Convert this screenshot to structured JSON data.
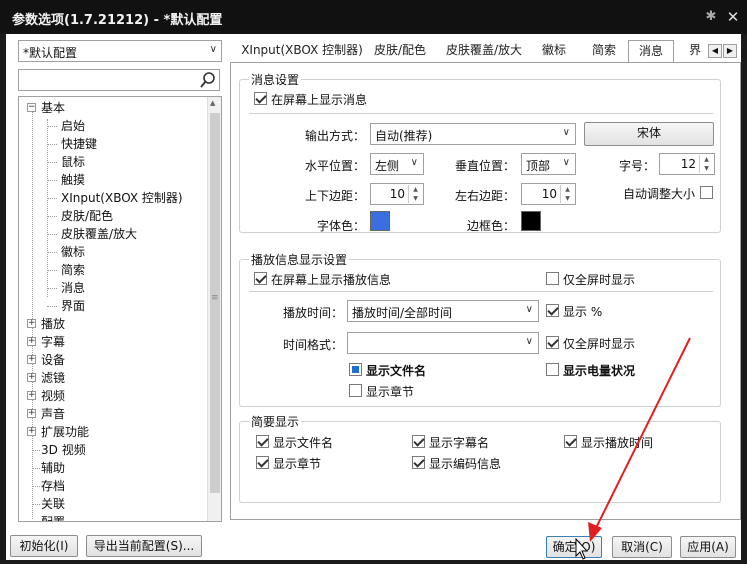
{
  "window": {
    "title": "参数选项(1.7.21212) - *默认配置",
    "pin_icon": "pin-icon",
    "close_icon": "close-icon"
  },
  "profile": {
    "selected": "*默认配置"
  },
  "search": {
    "value": "",
    "icon": "search-icon"
  },
  "tree": {
    "basic": "基本",
    "children": [
      "启始",
      "快捷键",
      "鼠标",
      "触摸",
      "XInput(XBOX 控制器)",
      "皮肤/配色",
      "皮肤覆盖/放大",
      "徽标",
      "简索",
      "消息",
      "界面"
    ],
    "others": [
      "播放",
      "字幕",
      "设备",
      "滤镜",
      "视频",
      "声音",
      "扩展功能",
      "3D 视频",
      "辅助",
      "存档",
      "关联",
      "配置"
    ]
  },
  "tabs": [
    "XInput(XBOX 控制器)",
    "皮肤/配色",
    "皮肤覆盖/放大",
    "徽标",
    "简索",
    "消息",
    "界"
  ],
  "active_tab": "消息",
  "msg": {
    "group_title": "消息设置",
    "show_on_screen": "在屏幕上显示消息",
    "output_label": "输出方式：",
    "output_value": "自动(推荐)",
    "font_button": "宋体",
    "hpos_label": "水平位置：",
    "hpos_value": "左侧",
    "vpos_label": "垂直位置：",
    "vpos_value": "顶部",
    "size_label": "字号：",
    "size_value": "12",
    "tb_margin_label": "上下边距：",
    "tb_margin_value": "10",
    "lr_margin_label": "左右边距：",
    "lr_margin_value": "10",
    "autosize_label": "自动调整大小",
    "font_color_label": "字体色：",
    "font_color": "#3b6fe0",
    "border_color_label": "边框色：",
    "border_color": "#000000"
  },
  "play": {
    "group_title": "播放信息显示设置",
    "show_play_info": "在屏幕上显示播放信息",
    "fullscreen_only": "仅全屏时显示",
    "time_label": "播放时间：",
    "time_value": "播放时间/全部时间",
    "show_percent": "显示 %",
    "format_label": "时间格式：",
    "format_value": "",
    "fullscreen_only2": "仅全屏时显示",
    "show_filename": "显示文件名",
    "show_battery": "显示电量状况",
    "show_chapter": "显示章节"
  },
  "brief": {
    "group_title": "简要显示",
    "items": [
      "显示文件名",
      "显示字幕名",
      "显示播放时间",
      "显示章节",
      "显示编码信息"
    ]
  },
  "buttons": {
    "init": "初始化(I)",
    "export": "导出当前配置(S)...",
    "ok": "确定(O)",
    "cancel": "取消(C)",
    "apply": "应用(A)"
  }
}
